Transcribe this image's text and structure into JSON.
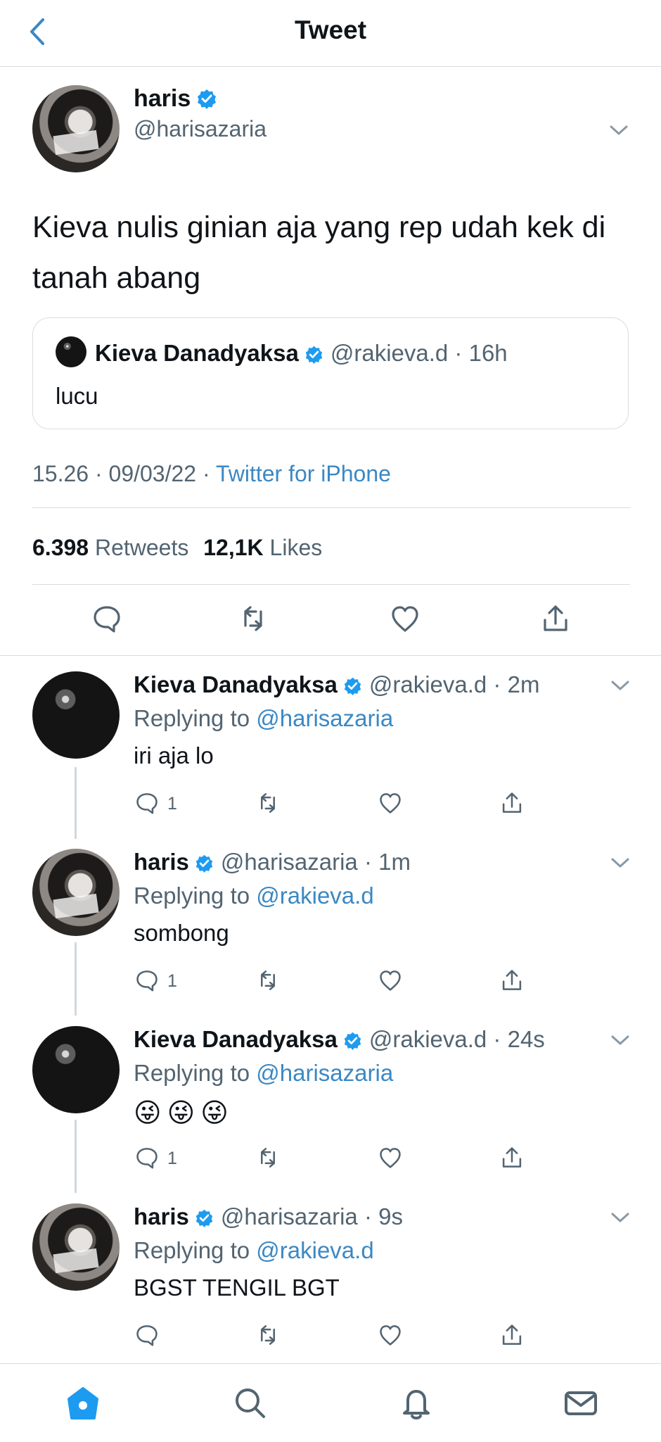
{
  "header": {
    "title": "Tweet",
    "back_icon": "chevron-left-icon"
  },
  "main_tweet": {
    "name": "haris",
    "handle": "@harisazaria",
    "text": "Kieva nulis ginian aja yang rep udah kek di tanah abang",
    "quote": {
      "name": "Kieva Danadyaksa",
      "handle": "@rakieva.d",
      "time": "16h",
      "text": "lucu"
    },
    "time": "15.26",
    "date": "09/03/22",
    "source": "Twitter for iPhone",
    "retweets": "6.398",
    "retweets_label": "Retweets",
    "likes": "12,1K",
    "likes_label": "Likes"
  },
  "replies": [
    {
      "name": "Kieva Danadyaksa",
      "handle": "@rakieva.d",
      "time": "2m",
      "replying_prefix": "Replying to",
      "replying_to": "@harisazaria",
      "text": "iri aja lo",
      "reply_count": "1"
    },
    {
      "name": "haris",
      "handle": "@harisazaria",
      "time": "1m",
      "replying_prefix": "Replying to",
      "replying_to": "@rakieva.d",
      "text": "sombong",
      "reply_count": "1"
    },
    {
      "name": "Kieva Danadyaksa",
      "handle": "@rakieva.d",
      "time": "24s",
      "replying_prefix": "Replying to",
      "replying_to": "@harisazaria",
      "text": "😜😜😜",
      "reply_count": "1"
    },
    {
      "name": "haris",
      "handle": "@harisazaria",
      "time": "9s",
      "replying_prefix": "Replying to",
      "replying_to": "@rakieva.d",
      "text": "BGST TENGIL BGT",
      "reply_count": ""
    }
  ],
  "icons": {
    "verified": "verified-badge-icon",
    "reply": "reply-icon",
    "retweet": "retweet-icon",
    "like": "heart-icon",
    "share": "share-icon",
    "more": "chevron-down-icon"
  },
  "bottom_nav": [
    {
      "icon": "home-icon"
    },
    {
      "icon": "search-icon"
    },
    {
      "icon": "notifications-icon"
    },
    {
      "icon": "messages-icon"
    }
  ],
  "colors": {
    "accent": "#3b88c3",
    "verified": "#1d9bf0",
    "text": "#0f1419",
    "secondary_text": "#536471",
    "divider": "#d8dde1"
  }
}
